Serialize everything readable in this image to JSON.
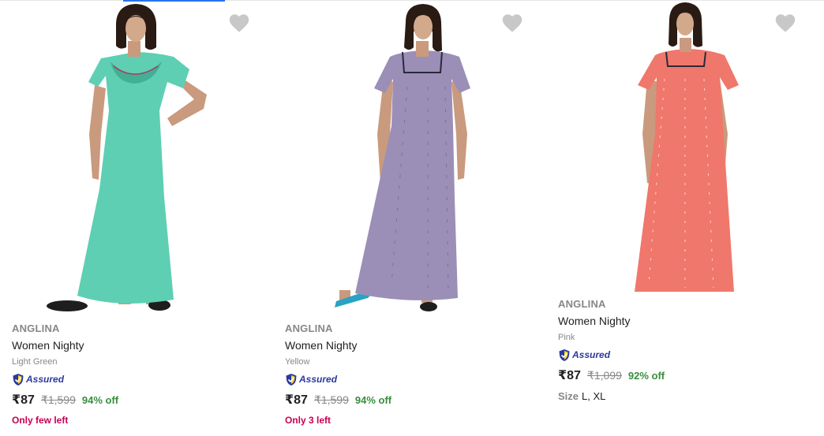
{
  "colors": {
    "accent": "#2874f0",
    "price_off": "#388e3c",
    "stock_warning": "#c70055",
    "assured_blue": "#2b3a9c",
    "heart": "#c8c8c8",
    "dress_light_green": "#5ecfb3",
    "dress_lavender": "#9b8fb8",
    "dress_pink": "#f0776b"
  },
  "products": [
    {
      "brand": "ANGLINA",
      "title": "Women Nighty",
      "color": "Light Green",
      "assured_label": "Assured",
      "price": "₹87",
      "mrp": "₹1,599",
      "discount": "94% off",
      "stock": "Only few left",
      "wishlist_icon": "heart-icon"
    },
    {
      "brand": "ANGLINA",
      "title": "Women Nighty",
      "color": "Yellow",
      "assured_label": "Assured",
      "price": "₹87",
      "mrp": "₹1,599",
      "discount": "94% off",
      "stock": "Only 3 left",
      "wishlist_icon": "heart-icon"
    },
    {
      "brand": "ANGLINA",
      "title": "Women Nighty",
      "color": "Pink",
      "assured_label": "Assured",
      "price": "₹87",
      "mrp": "₹1,099",
      "discount": "92% off",
      "size_label": "Size",
      "size_values": "L, XL",
      "wishlist_icon": "heart-icon"
    }
  ]
}
